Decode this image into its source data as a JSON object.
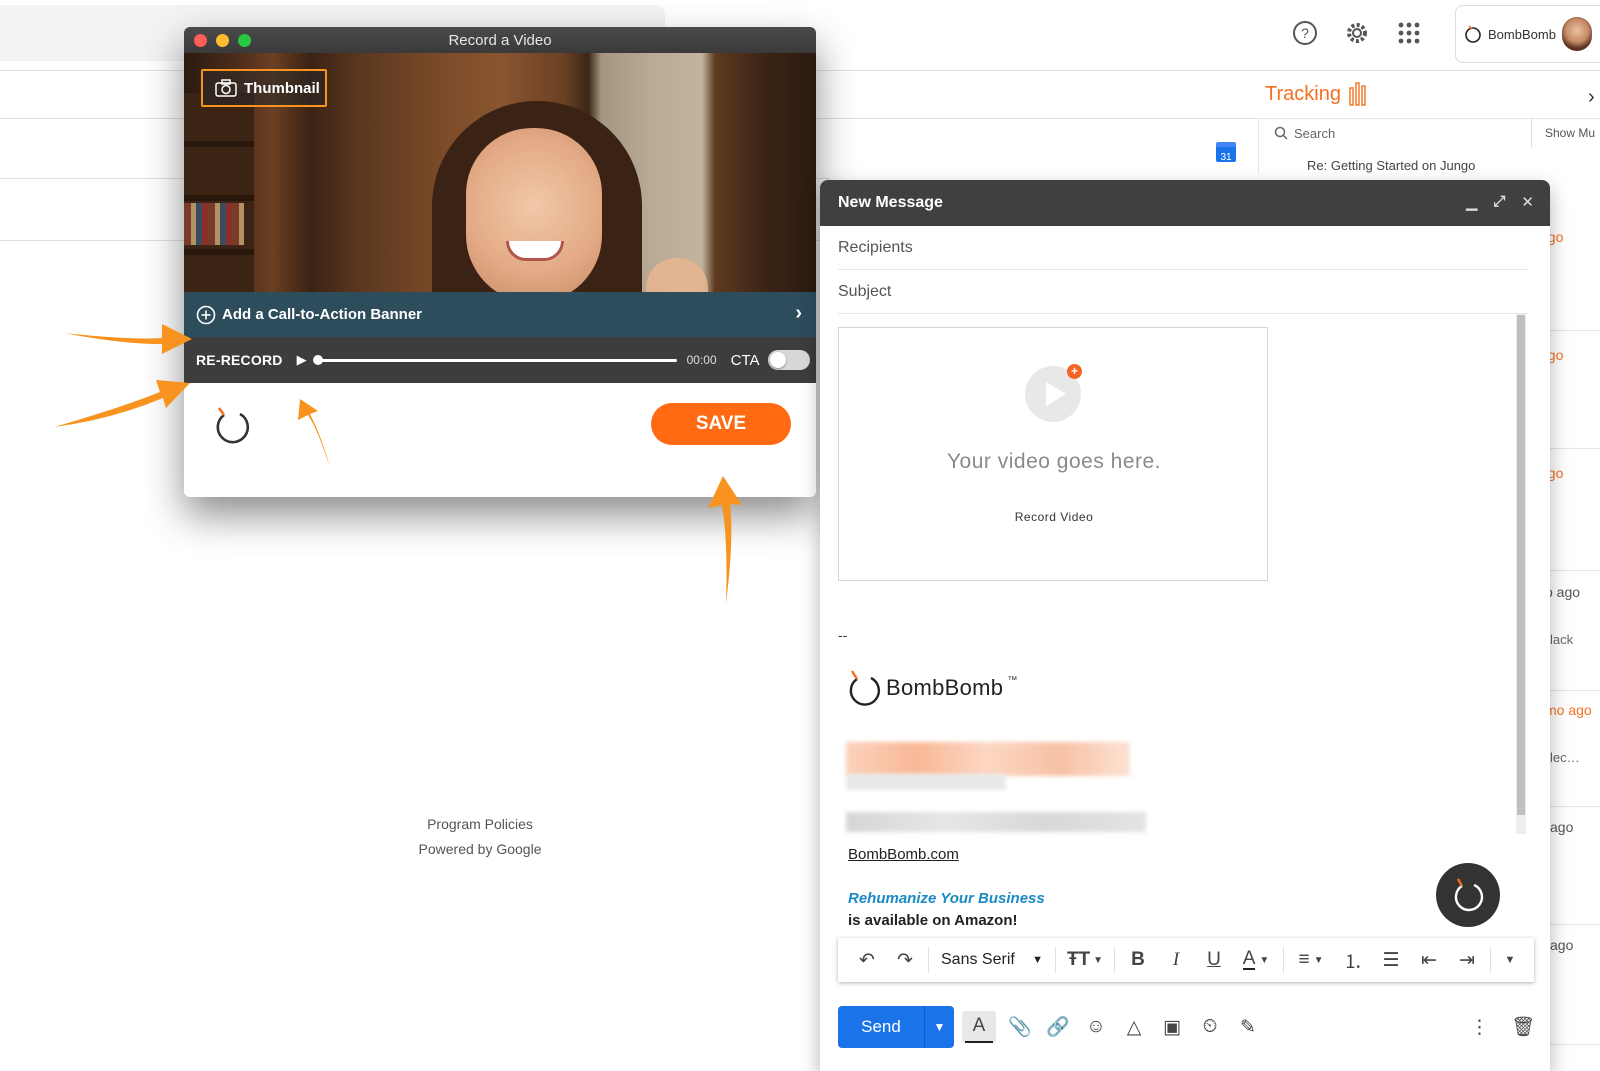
{
  "gmail": {
    "tracking_label": "Tracking",
    "sidebar_search_placeholder": "Search",
    "show_more_label": "Show Mu",
    "calendar_day": "31",
    "sidebar_subject": "Re: Getting Started on Jungo",
    "account_brand": "BombBomb",
    "time_items": [
      {
        "text": "ago",
        "tone": "orange"
      },
      {
        "text": "ago",
        "tone": "orange"
      },
      {
        "text": "ago",
        "tone": "orange"
      },
      {
        "text": "o ago",
        "tone": "gray"
      },
      {
        "text": "mo ago",
        "tone": "orange"
      },
      {
        "text": "ago",
        "tone": "gray"
      },
      {
        "text": "ago",
        "tone": "gray"
      }
    ],
    "side_subtexts": [
      "lack",
      "lec…"
    ],
    "footer": {
      "program_policies": "Program Policies",
      "powered_by": "Powered by Google"
    }
  },
  "recorder": {
    "window_title": "Record a Video",
    "thumbnail_label": "Thumbnail",
    "cta_banner_label": "Add a Call-to-Action Banner",
    "rerecord_label": "RE-RECORD",
    "time": "00:00",
    "cta_toggle_label": "CTA",
    "cta_toggle_on": false,
    "save_label": "SAVE",
    "playback_progress": 0.0
  },
  "compose": {
    "title": "New Message",
    "recipients_placeholder": "Recipients",
    "subject_placeholder": "Subject",
    "video_placeholder_text": "Your video goes here.",
    "video_record_label": "Record Video",
    "signature_dash": "--",
    "signature_brand": "BombBomb",
    "signature_tm": "™",
    "signature_link": "BombBomb.com",
    "signature_book_title": "Rehumanize Your Business",
    "signature_book_line": "is available on Amazon!",
    "font_family_label": "Sans Serif",
    "send_label": "Send"
  },
  "colors": {
    "accent_orange": "#ff6a13",
    "tracking_orange": "#f37021",
    "gmail_blue": "#1a73e8",
    "annotation_arrow": "#f7931e"
  }
}
